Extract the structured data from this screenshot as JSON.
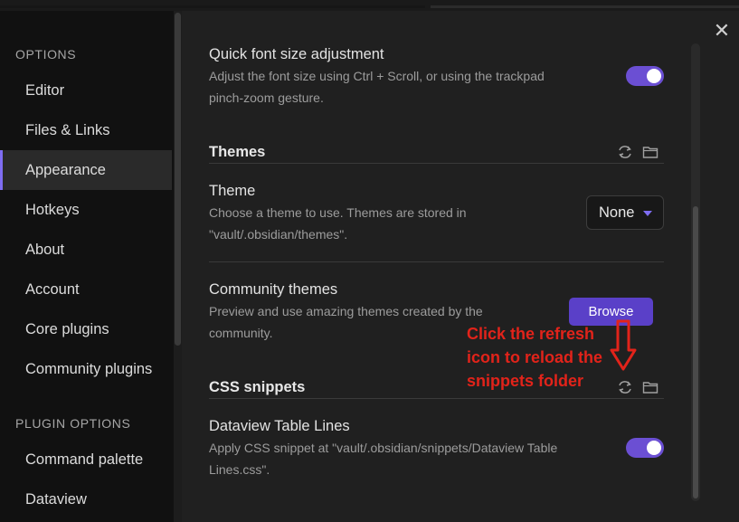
{
  "sidebar": {
    "options_heading": "OPTIONS",
    "items": [
      {
        "label": "Editor"
      },
      {
        "label": "Files & Links"
      },
      {
        "label": "Appearance"
      },
      {
        "label": "Hotkeys"
      },
      {
        "label": "About"
      },
      {
        "label": "Account"
      },
      {
        "label": "Core plugins"
      },
      {
        "label": "Community plugins"
      }
    ],
    "plugin_heading": "PLUGIN OPTIONS",
    "plugin_items": [
      {
        "label": "Command palette"
      },
      {
        "label": "Dataview"
      }
    ],
    "active_item": "Appearance"
  },
  "main": {
    "quick_font": {
      "name": "Quick font size adjustment",
      "desc1": "Adjust the font size using Ctrl + Scroll, or using the trackpad",
      "desc2": "pinch-zoom gesture.",
      "enabled": true
    },
    "themes": {
      "heading": "Themes",
      "theme_name": "Theme",
      "theme_desc1": "Choose a theme to use. Themes are stored in",
      "theme_desc2": "\"vault/.obsidian/themes\".",
      "theme_value": "None",
      "community_name": "Community themes",
      "community_desc1": "Preview and use amazing themes created by the",
      "community_desc2": "community.",
      "browse_label": "Browse"
    },
    "snippets": {
      "heading": "CSS snippets",
      "item_name": "Dataview Table Lines",
      "item_desc1": "Apply CSS snippet at \"vault/.obsidian/snippets/Dataview Table",
      "item_desc2": "Lines.css\".",
      "enabled": true
    }
  },
  "annotation": {
    "line1": "Click the refresh",
    "line2": "icon to reload the",
    "line3": "snippets folder"
  },
  "icons": {
    "close": "close-icon",
    "refresh": "refresh-icon",
    "folder": "folder-icon",
    "arrow": "down-arrow-annotation"
  },
  "colors": {
    "accent": "#7f6df2",
    "toggle_on": "#6b4fd3",
    "button": "#5a40c8",
    "annotation": "#e2231a"
  }
}
